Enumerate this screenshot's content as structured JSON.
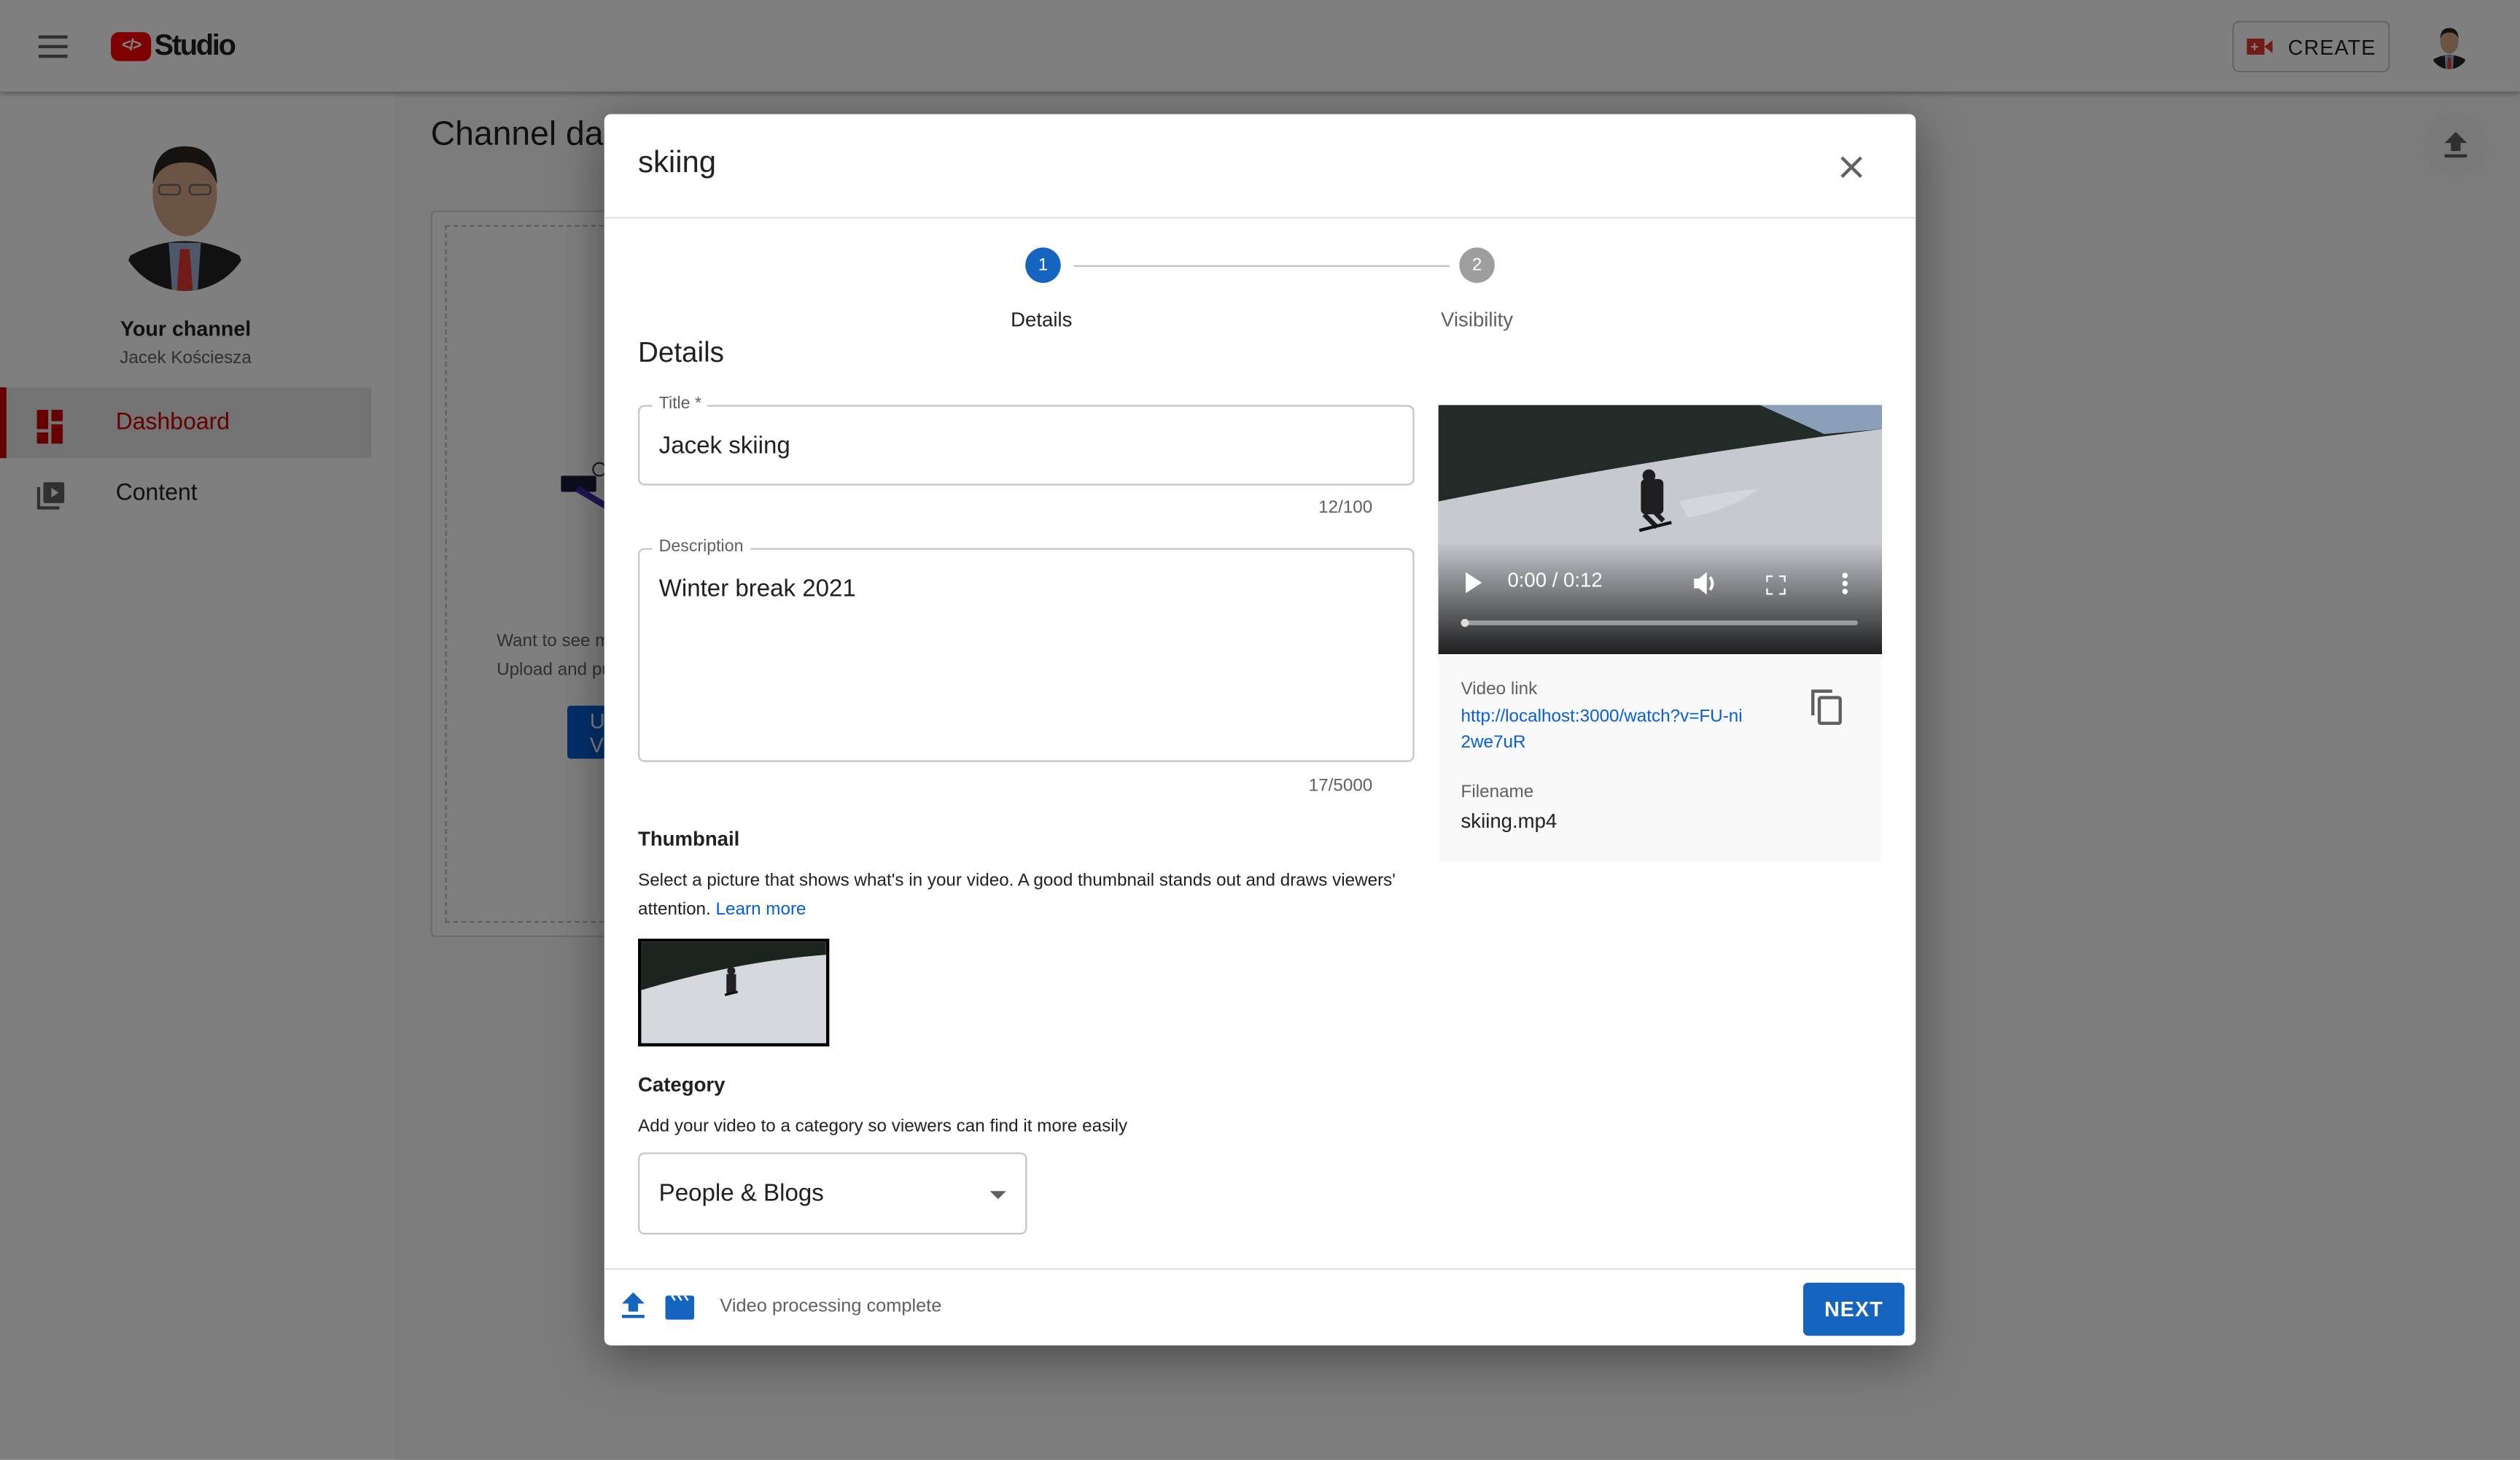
{
  "app": {
    "logo_badge": "</>",
    "logo_text": "Studio",
    "create_label": "CREATE",
    "colors": {
      "brand_red": "#ff0000",
      "accent_blue": "#065fd4",
      "primary_button": "#1565c0"
    }
  },
  "sidebar": {
    "channel_title": "Your channel",
    "channel_name": "Jacek Kościesza",
    "items": [
      {
        "label": "Dashboard",
        "icon": "dashboard-icon",
        "active": true
      },
      {
        "label": "Content",
        "icon": "video-library-icon",
        "active": false
      }
    ]
  },
  "main": {
    "title": "Channel dashboard",
    "card_text_line1": "Want to see metrics on your recent video?",
    "card_text_line2": "Upload and publish a video to get started.",
    "card_button": "UPLOAD VIDEOS"
  },
  "modal": {
    "title": "skiing",
    "stepper": [
      {
        "number": "1",
        "label": "Details",
        "active": true
      },
      {
        "number": "2",
        "label": "Visibility",
        "active": false
      }
    ],
    "section_heading": "Details",
    "title_field": {
      "label": "Title *",
      "value": "Jacek skiing",
      "counter": "12/100"
    },
    "description_field": {
      "label": "Description",
      "value": "Winter break 2021",
      "counter": "17/5000"
    },
    "thumbnail": {
      "heading": "Thumbnail",
      "text": "Select a picture that shows what's in your video. A good thumbnail stands out and draws viewers' attention.",
      "link": "Learn more"
    },
    "category": {
      "heading": "Category",
      "text": "Add your video to a category so viewers can find it more easily",
      "selected": "People & Blogs"
    },
    "video": {
      "time": "0:00 / 0:12",
      "progress": 0
    },
    "info": {
      "link_label": "Video link",
      "link_value": "http://localhost:3000/watch?v=FU-ni2we7uR",
      "filename_label": "Filename",
      "filename_value": "skiing.mp4"
    },
    "footer": {
      "status": "Video processing complete",
      "next_label": "NEXT"
    }
  }
}
